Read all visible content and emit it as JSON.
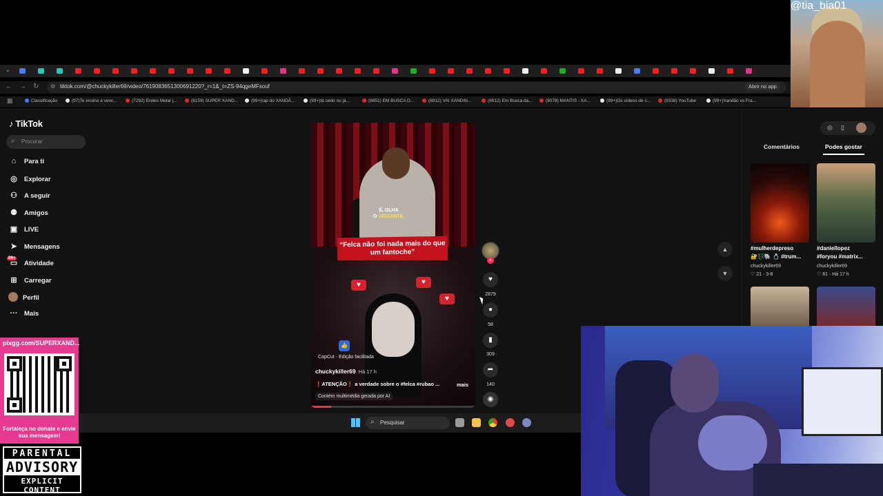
{
  "browser": {
    "url": "tiktok.com/@chuckykiller69/video/7619083651300691220?_r=1&_t=ZS-94qgeMFsouf",
    "open_app": "Abrir no app",
    "bookmarks": [
      "Classificação",
      "(97)Te ensino a venc...",
      "(7292) Ereles Metal |...",
      "(8159) SUPER XAND...",
      "(99+)rap do XANDÃ...",
      "(99+)tá cedo ou já...",
      "(8851) EM BUSCA D...",
      "(8912) VAI XANDIN...",
      "(8912) Em Busca da...",
      "(9078) MANTIS - XA...",
      "(99+)Os vídeos de c...",
      "(9338) YouTube",
      "(99+)Xandão vs Fra..."
    ]
  },
  "tiktok": {
    "logo": "TikTok",
    "search_placeholder": "Procurar",
    "nav": [
      {
        "label": "Para ti",
        "icon": "home-icon"
      },
      {
        "label": "Explorar",
        "icon": "compass-icon"
      },
      {
        "label": "A seguir",
        "icon": "following-icon"
      },
      {
        "label": "Amigos",
        "icon": "friends-icon"
      },
      {
        "label": "LIVE",
        "icon": "live-icon"
      },
      {
        "label": "Mensagens",
        "icon": "messages-icon"
      },
      {
        "label": "Atividade",
        "icon": "activity-icon",
        "badge": "99+"
      },
      {
        "label": "Carregar",
        "icon": "upload-icon"
      },
      {
        "label": "Perfil",
        "icon": "avatar"
      },
      {
        "label": "Mais",
        "icon": "more-icon"
      }
    ],
    "video": {
      "caption_line1": "É, OLHA",
      "caption_line2": "O",
      "caption_highlight": "SEGUINTE,",
      "quote": "“Felca não foi nada mais do que um fantoche”",
      "capcut": "CapCut · Edição facilitada",
      "author": "chuckykiller69",
      "time": "Há 17 h",
      "description": "❗ATENÇÃO❗ a verdade sobre o #felca #rubao ...",
      "more": "mais",
      "ai_label": "Contém multimédia gerada por AI",
      "progress": 0.12
    },
    "actions": {
      "likes": "2879",
      "comments": "58",
      "saves": "309",
      "shares": "140"
    },
    "right_panel": {
      "tab_comments": "Comentários",
      "tab_likes": "Podes gostar",
      "items": [
        {
          "title": "#mulherdepreso",
          "tags": "🔐💱🐘 💍 #trum...",
          "author": "chuckykiller69",
          "stats": "♡ 21 · 3-8"
        },
        {
          "title": "#daniellopez",
          "tags": "#foryou #matrix...",
          "author": "chuckykiller69",
          "stats": "♡ 81 · Há 17 h"
        }
      ]
    }
  },
  "taskbar": {
    "search_placeholder": "Pesquisar"
  },
  "overlays": {
    "top_cam_handle": "@tia_bia01",
    "qr_title": "pixgg.com/SUPERXAND...",
    "qr_message": "Fortaleça no donate e envie sua mensagem!",
    "advisory_line1": "PARENTAL",
    "advisory_line2": "ADVISORY",
    "advisory_line3": "EXPLICIT CONTENT"
  }
}
